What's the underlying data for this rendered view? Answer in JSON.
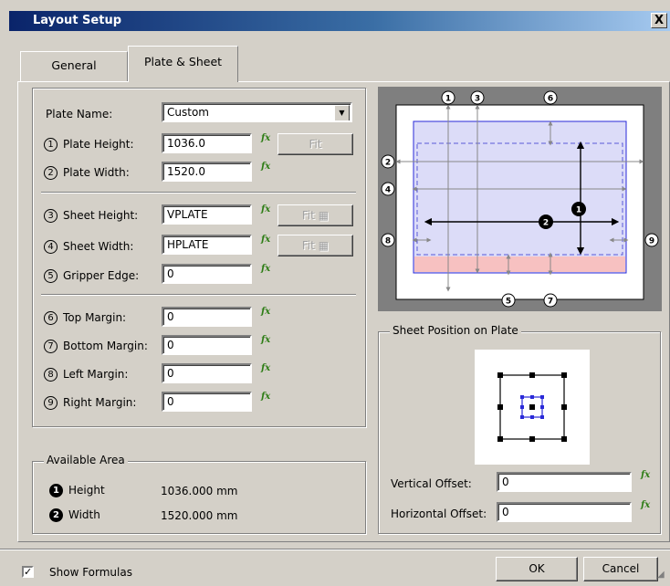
{
  "window": {
    "title": "Layout Setup",
    "close_glyph": "X"
  },
  "tabs": [
    {
      "label": "General",
      "active": false
    },
    {
      "label": "Plate & Sheet",
      "active": true
    }
  ],
  "fx_label": "fx",
  "plate_name": {
    "label": "Plate Name:",
    "value": "Custom"
  },
  "fields": {
    "plate_height": {
      "num": "1",
      "label": "Plate Height:",
      "value": "1036.0"
    },
    "plate_width": {
      "num": "2",
      "label": "Plate Width:",
      "value": "1520.0"
    },
    "sheet_height": {
      "num": "3",
      "label": "Sheet Height:",
      "value": "VPLATE"
    },
    "sheet_width": {
      "num": "4",
      "label": "Sheet Width:",
      "value": "HPLATE"
    },
    "gripper_edge": {
      "num": "5",
      "label": "Gripper Edge:",
      "value": "0"
    },
    "top_margin": {
      "num": "6",
      "label": "Top Margin:",
      "value": "0"
    },
    "bottom_margin": {
      "num": "7",
      "label": "Bottom Margin:",
      "value": "0"
    },
    "left_margin": {
      "num": "8",
      "label": "Left Margin:",
      "value": "0"
    },
    "right_margin": {
      "num": "9",
      "label": "Right Margin:",
      "value": "0"
    }
  },
  "buttons": {
    "fit_plate": "Fit",
    "fit_sheet_height": "Fit",
    "fit_sheet_width": "Fit",
    "ok": "OK",
    "cancel": "Cancel"
  },
  "available_area": {
    "caption": "Available Area",
    "height": {
      "num": "1",
      "label": "Height",
      "value": "1036.000 mm"
    },
    "width": {
      "num": "2",
      "label": "Width",
      "value": "1520.000 mm"
    }
  },
  "sheet_position": {
    "caption": "Sheet Position on Plate",
    "vertical_offset": {
      "label": "Vertical Offset:",
      "value": "0"
    },
    "horizontal_offset": {
      "label": "Horizontal Offset:",
      "value": "0"
    }
  },
  "show_formulas": {
    "label": "Show Formulas",
    "checked": true,
    "check_glyph": "✓"
  },
  "diagram_callouts": [
    "1",
    "2",
    "3",
    "4",
    "5",
    "6",
    "7",
    "8",
    "9"
  ],
  "colors": {
    "sheet_fill": "#dcdcf8",
    "sheet_border": "#2a2ad8",
    "gripper_fill": "#f7c1c1",
    "fx_green": "#2e7d16",
    "title_gradient_start": "#0a246a"
  }
}
